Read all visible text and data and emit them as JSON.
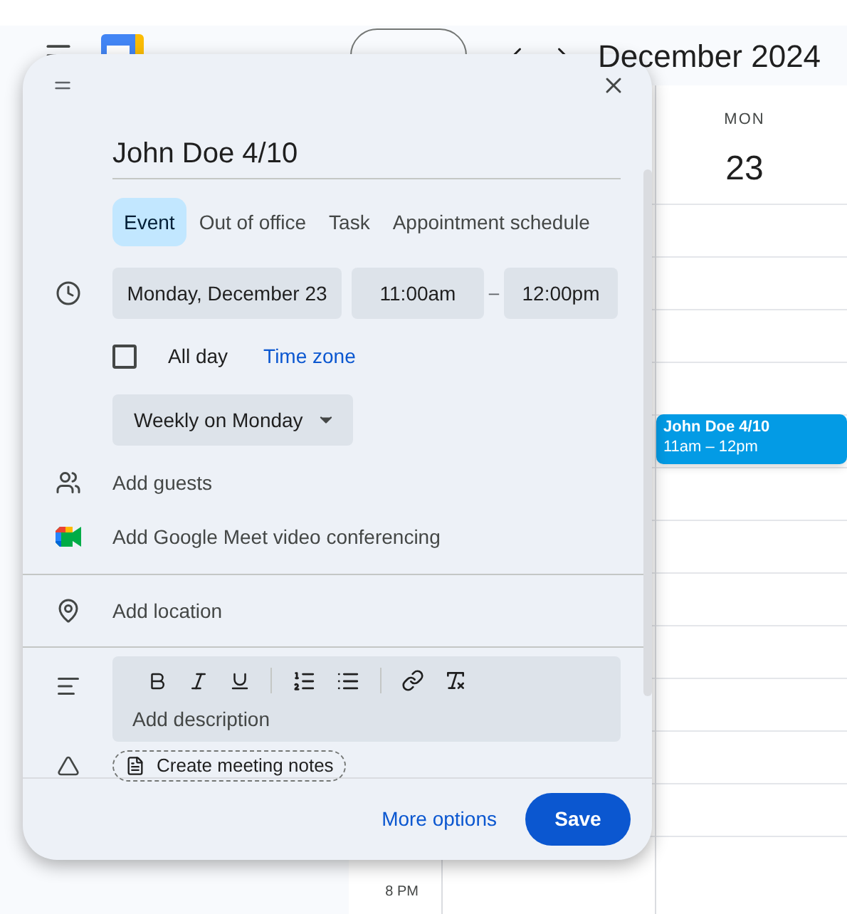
{
  "header": {
    "month": "December 2024"
  },
  "calendar": {
    "day_label": "MON",
    "day_number": "23",
    "time_label": "8 PM",
    "event": {
      "title": "John Doe 4/10",
      "time": "11am – 12pm",
      "color": "#039be5"
    }
  },
  "dialog": {
    "title": "John Doe 4/10",
    "tabs": [
      {
        "label": "Event",
        "selected": true
      },
      {
        "label": "Out of office",
        "selected": false
      },
      {
        "label": "Task",
        "selected": false
      },
      {
        "label": "Appointment schedule",
        "selected": false
      }
    ],
    "date": "Monday, December 23",
    "start": "11:00am",
    "dash": "–",
    "end": "12:00pm",
    "all_day": {
      "label": "All day",
      "checked": false
    },
    "time_zone": "Time zone",
    "recurrence": "Weekly on Monday",
    "guests": "Add guests",
    "meet": "Add Google Meet video conferencing",
    "location": "Add location",
    "description": {
      "placeholder": "Add description"
    },
    "meeting_notes": "Create meeting notes",
    "more_options": "More options",
    "save": "Save"
  }
}
